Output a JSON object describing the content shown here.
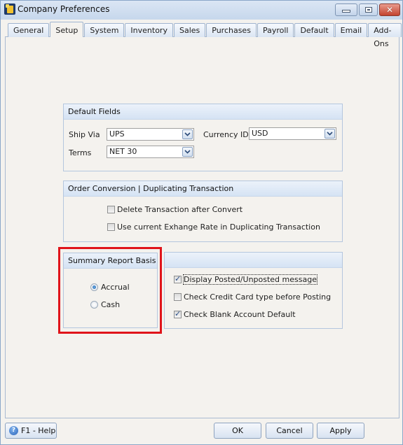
{
  "window": {
    "title": "Company Preferences",
    "controls": {
      "minimize": "minimize",
      "maximize": "maximize",
      "close": "close"
    }
  },
  "tabs": [
    {
      "label": "General",
      "active": false
    },
    {
      "label": "Setup",
      "active": true
    },
    {
      "label": "System",
      "active": false
    },
    {
      "label": "Inventory",
      "active": false
    },
    {
      "label": "Sales",
      "active": false
    },
    {
      "label": "Purchases",
      "active": false
    },
    {
      "label": "Payroll",
      "active": false
    },
    {
      "label": "Default",
      "active": false
    },
    {
      "label": "Email",
      "active": false
    },
    {
      "label": "Add-Ons",
      "active": false
    }
  ],
  "default_fields": {
    "header": "Default Fields",
    "ship_via": {
      "label": "Ship Via",
      "value": "UPS"
    },
    "currency_id": {
      "label": "Currency ID",
      "value": "USD"
    },
    "terms": {
      "label": "Terms",
      "value": "NET 30"
    }
  },
  "order_conversion": {
    "header": "Order Conversion | Duplicating Transaction",
    "options": [
      {
        "label": "Delete Transaction after Convert",
        "checked": false
      },
      {
        "label": "Use current Exhange Rate in Duplicating Transaction",
        "checked": false
      }
    ]
  },
  "summary_report_basis": {
    "header": "Summary Report Basis",
    "options": [
      {
        "label": "Accrual",
        "selected": true
      },
      {
        "label": "Cash",
        "selected": false
      }
    ],
    "highlight_color": "#e0141a"
  },
  "posting_options": {
    "header": "",
    "options": [
      {
        "label": "Display Posted/Unposted message",
        "checked": true,
        "focused": true
      },
      {
        "label": "Check Credit Card type before Posting",
        "checked": false
      },
      {
        "label": "Check Blank Account Default",
        "checked": true
      }
    ]
  },
  "footer": {
    "help_label": "F1 - Help",
    "ok_label": "OK",
    "cancel_label": "Cancel",
    "apply_label": "Apply"
  }
}
